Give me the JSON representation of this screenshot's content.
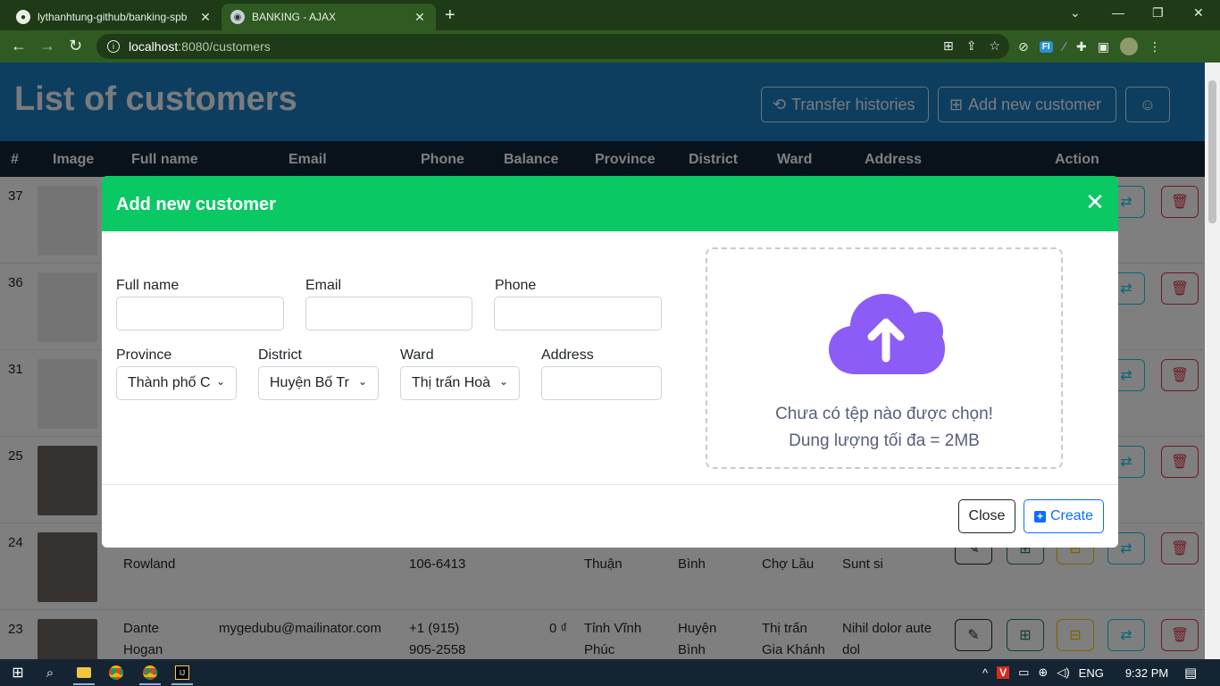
{
  "browser": {
    "tabs": [
      {
        "title": "lythanhtung-github/banking-spb",
        "active": false
      },
      {
        "title": "BANKING - AJAX",
        "active": true
      }
    ],
    "address": {
      "host": "localhost",
      "path": ":8080/customers"
    }
  },
  "page": {
    "title": "List of customers",
    "header_buttons": {
      "transfer": "Transfer histories",
      "add": "Add new customer"
    },
    "table": {
      "columns": [
        "#",
        "Image",
        "Full name",
        "Email",
        "Phone",
        "Balance",
        "Province",
        "District",
        "Ward",
        "Address",
        "Action"
      ],
      "rows": [
        {
          "id": "37"
        },
        {
          "id": "36"
        },
        {
          "id": "31"
        },
        {
          "id": "25"
        },
        {
          "id": "24",
          "name": "Rowland",
          "phone": "106-6413",
          "province": "Thuận",
          "district": "Bình",
          "ward": "Chợ Lầu",
          "address": "Sunt si"
        },
        {
          "id": "23",
          "name_line1": "Dante",
          "name_line2": "Hogan",
          "email": "mygedubu@mailinator.com",
          "phone_line1": "+1 (915)",
          "phone_line2": "905-2558",
          "balance": "0 ₫",
          "province_line1": "Tỉnh Vĩnh",
          "province_line2": "Phúc",
          "district_line1": "Huyện",
          "district_line2": "Bình",
          "ward_line1": "Thị trấn",
          "ward_line2": "Gia Khánh",
          "address_line1": "Nihil dolor aute",
          "address_line2": "dol"
        }
      ]
    }
  },
  "modal": {
    "title": "Add new customer",
    "fields": {
      "full_name": {
        "label": "Full name",
        "value": ""
      },
      "email": {
        "label": "Email",
        "value": ""
      },
      "phone": {
        "label": "Phone",
        "value": ""
      },
      "province": {
        "label": "Province",
        "selected": "Thành phố C"
      },
      "district": {
        "label": "District",
        "selected": "Huyện Bố Tr"
      },
      "ward": {
        "label": "Ward",
        "selected": "Thị trấn Hoà"
      },
      "address": {
        "label": "Address",
        "value": ""
      }
    },
    "upload": {
      "line1": "Chưa có tệp nào được chọn!",
      "line2": "Dung lượng tối đa = 2MB",
      "icon": "cloud-upload-icon",
      "icon_color": "#8b5cf6"
    },
    "buttons": {
      "close": "Close",
      "create": "Create"
    },
    "header_color": "#0ac964"
  },
  "taskbar": {
    "lang": "ENG",
    "time": "9:32 PM"
  }
}
